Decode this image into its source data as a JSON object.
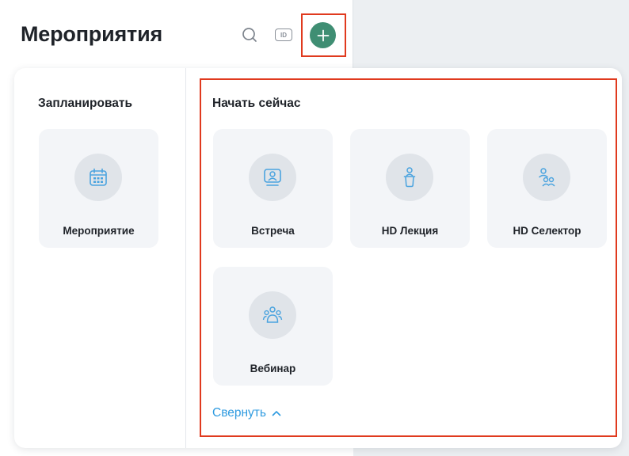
{
  "header": {
    "title": "Мероприятия",
    "id_badge": "ID",
    "icons": [
      "search-icon",
      "id-icon",
      "plus-icon"
    ]
  },
  "schedule": {
    "title": "Запланировать",
    "items": [
      {
        "label": "Мероприятие",
        "icon": "calendar-icon"
      }
    ]
  },
  "start_now": {
    "title": "Начать сейчас",
    "items": [
      {
        "label": "Встреча",
        "icon": "screen-user-icon"
      },
      {
        "label": "HD Лекция",
        "icon": "speaker-podium-icon"
      },
      {
        "label": "HD Селектор",
        "icon": "group-icon"
      },
      {
        "label": "Вебинар",
        "icon": "audience-icon"
      }
    ],
    "collapse_label": "Свернуть"
  },
  "colors": {
    "accent_green": "#3f8e73",
    "icon_blue": "#4aa3df",
    "link_blue": "#2f9be0",
    "highlight_red": "#e03a1e",
    "card_bg": "#f3f5f8"
  }
}
